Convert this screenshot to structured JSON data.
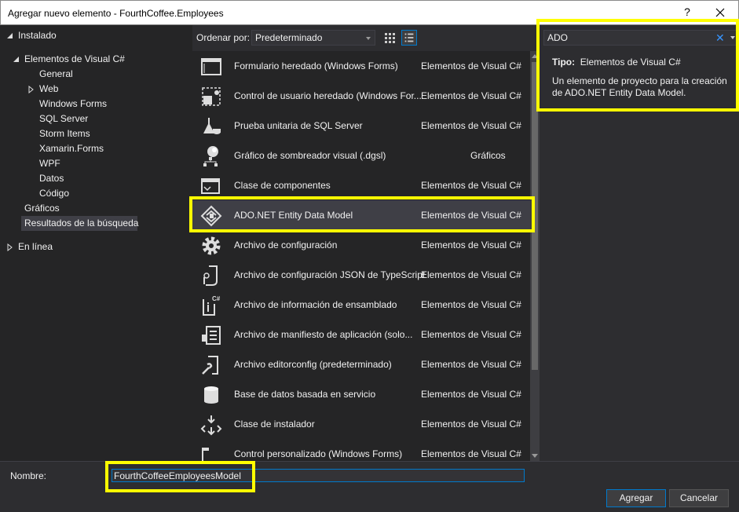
{
  "window": {
    "title": "Agregar nuevo elemento - FourthCoffee.Employees",
    "help_label": "?"
  },
  "tree": {
    "installed_label": "Instalado",
    "vcsharp_label": "Elementos de Visual C#",
    "children": [
      "General",
      "Web",
      "Windows Forms",
      "SQL Server",
      "Storm Items",
      "Xamarin.Forms",
      "WPF",
      "Datos",
      "Código"
    ],
    "graphics_label": "Gráficos",
    "search_results_label": "Resultados de la búsqueda",
    "online_label": "En línea"
  },
  "sort": {
    "label": "Ordenar por:",
    "value": "Predeterminado"
  },
  "items": [
    {
      "name": "Formulario heredado (Windows Forms)",
      "category": "Elementos de Visual C#",
      "icon": "form-icon"
    },
    {
      "name": "Control de usuario heredado (Windows For...",
      "category": "Elementos de Visual C#",
      "icon": "user-control-icon"
    },
    {
      "name": "Prueba unitaria de SQL Server",
      "category": "Elementos de Visual C#",
      "icon": "flask-icon"
    },
    {
      "name": "Gráfico de sombreador visual (.dgsl)",
      "category": "Gráficos",
      "icon": "shader-graph-icon"
    },
    {
      "name": "Clase de componentes",
      "category": "Elementos de Visual C#",
      "icon": "component-icon"
    },
    {
      "name": "ADO.NET Entity Data Model",
      "category": "Elementos de Visual C#",
      "icon": "entity-model-icon"
    },
    {
      "name": "Archivo de configuración",
      "category": "Elementos de Visual C#",
      "icon": "gear-icon"
    },
    {
      "name": "Archivo de configuración JSON de TypeScript",
      "category": "Elementos de Visual C#",
      "icon": "json-config-icon"
    },
    {
      "name": "Archivo de información de ensamblado",
      "category": "Elementos de Visual C#",
      "icon": "assembly-info-icon"
    },
    {
      "name": "Archivo de manifiesto de aplicación (solo...",
      "category": "Elementos de Visual C#",
      "icon": "manifest-icon"
    },
    {
      "name": "Archivo editorconfig (predeterminado)",
      "category": "Elementos de Visual C#",
      "icon": "wrench-file-icon"
    },
    {
      "name": "Base de datos basada en servicio",
      "category": "Elementos de Visual C#",
      "icon": "database-icon"
    },
    {
      "name": "Clase de instalador",
      "category": "Elementos de Visual C#",
      "icon": "installer-icon"
    },
    {
      "name": "Control personalizado (Windows Forms)",
      "category": "Elementos de Visual C#",
      "icon": "custom-control-icon"
    }
  ],
  "search": {
    "value": "ADO"
  },
  "details": {
    "type_label": "Tipo:",
    "type_value": "Elementos de Visual C#",
    "description": "Un elemento de proyecto para la creación de ADO.NET Entity Data Model."
  },
  "footer": {
    "name_label": "Nombre:",
    "name_value": "FourthCoffeeEmployeesModel",
    "add_label": "Agregar",
    "cancel_label": "Cancelar"
  },
  "colors": {
    "accent": "#007acc",
    "highlight": "#ffff00",
    "background": "#2d2d30"
  }
}
